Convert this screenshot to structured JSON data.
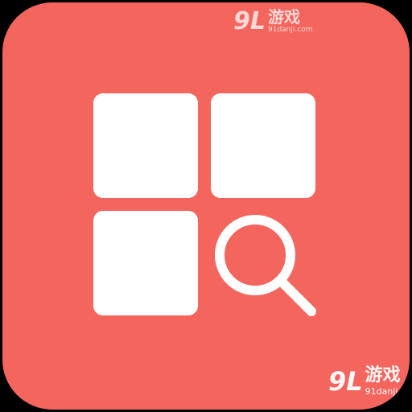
{
  "app_icon": {
    "background_color": "#f4655d",
    "foreground_color": "#ffffff",
    "glyph": "grid-search-icon"
  },
  "watermarks": [
    {
      "logo": "9L",
      "title": "游戏",
      "url": "91danji.com"
    },
    {
      "logo": "9L",
      "title": "游戏",
      "url": "91danji.com"
    }
  ]
}
